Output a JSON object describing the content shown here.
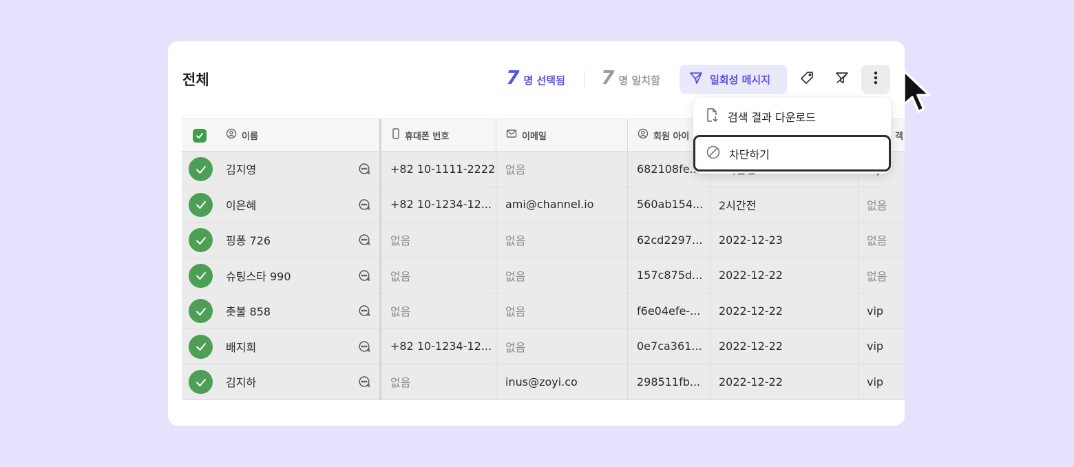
{
  "page": {
    "title": "전체",
    "selected_count": "7",
    "selected_label": "명 선택됨",
    "matched_count": "7",
    "matched_label": "명 일치함",
    "message_button": "일회성 메시지",
    "accent_color": "#5a55dd",
    "check_color": "#4c9f55"
  },
  "toolbar_icons": [
    "send-icon",
    "tag-icon",
    "filter-off-icon",
    "more-vertical-icon"
  ],
  "columns": [
    {
      "label": "이름",
      "icon": "user-circle-icon"
    },
    {
      "label": "휴대폰 번호",
      "icon": "phone-icon"
    },
    {
      "label": "이메일",
      "icon": "mail-icon"
    },
    {
      "label": "회원 아이",
      "icon": "user-circle-icon"
    },
    {
      "label": "",
      "icon": ""
    },
    {
      "label": "객",
      "icon": ""
    }
  ],
  "rows": [
    {
      "name": "김지영",
      "phone": "+82 10-1111-2222",
      "email": "없음",
      "member_id": "682108fe...",
      "last_seen": "2시간전",
      "tag": "vip"
    },
    {
      "name": "이은혜",
      "phone": "+82 10-1234-12...",
      "email": "ami@channel.io",
      "member_id": "560ab154...",
      "last_seen": "2시간전",
      "tag": "없음"
    },
    {
      "name": "핑퐁 726",
      "phone": "없음",
      "email": "없음",
      "member_id": "62cd2297...",
      "last_seen": "2022-12-23",
      "tag": "없음"
    },
    {
      "name": "슈팅스타 990",
      "phone": "없음",
      "email": "없음",
      "member_id": "157c875d...",
      "last_seen": "2022-12-22",
      "tag": "없음"
    },
    {
      "name": "촛불 858",
      "phone": "없음",
      "email": "없음",
      "member_id": "f6e04efe-...",
      "last_seen": "2022-12-22",
      "tag": "vip"
    },
    {
      "name": "배지희",
      "phone": "+82 10-1234-12...",
      "email": "없음",
      "member_id": "0e7ca361...",
      "last_seen": "2022-12-22",
      "tag": "vip"
    },
    {
      "name": "김지하",
      "phone": "없음",
      "email": "inus@zoyi.co",
      "member_id": "298511fb...",
      "last_seen": "2022-12-22",
      "tag": "vip"
    }
  ],
  "empty_value": "없음",
  "dropdown": {
    "download_label": "검색 결과 다운로드",
    "block_label": "차단하기"
  }
}
